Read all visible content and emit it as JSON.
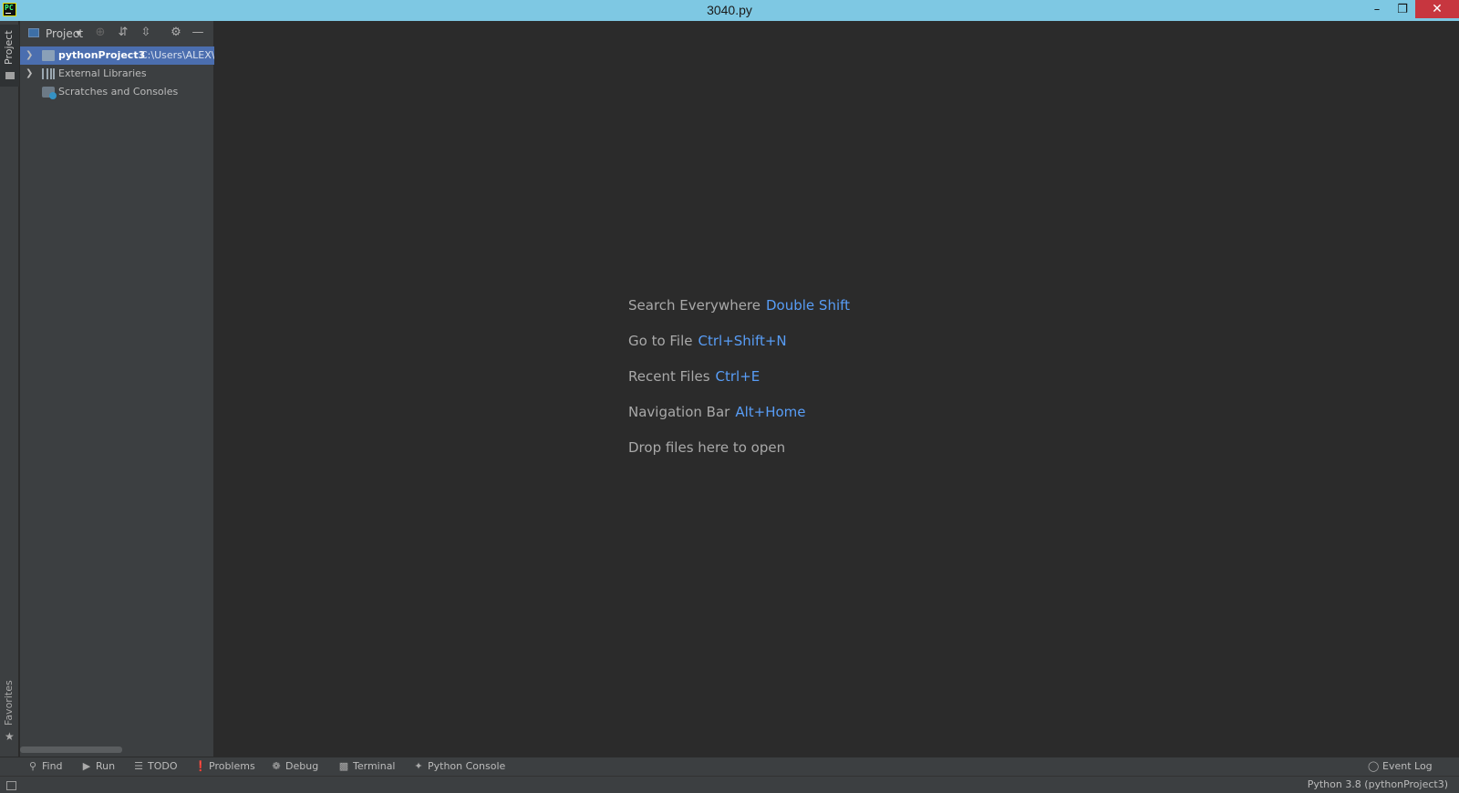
{
  "window": {
    "title": "3040.py",
    "icon_label": "PC",
    "minimize": "–",
    "restore": "❐",
    "close": "✕"
  },
  "left_strip": {
    "project_tab": "Project",
    "favorites_tab": "Favorites",
    "favorites_icon": "★"
  },
  "project_panel": {
    "title": "Project",
    "toolbar_icons": [
      "view-icon",
      "dropdown-icon",
      "locate-icon",
      "expand-all-icon",
      "collapse-all-icon",
      "settings-icon",
      "hide-icon"
    ],
    "tree": [
      {
        "label": "pythonProject3",
        "path": "C:\\Users\\ALEX\\",
        "expanded": false,
        "selected": true
      },
      {
        "label": "External Libraries",
        "expanded": false
      },
      {
        "label": "Scratches and Consoles"
      }
    ]
  },
  "editor": {
    "hints": [
      {
        "label": "Search Everywhere",
        "key": "Double Shift"
      },
      {
        "label": "Go to File",
        "key": "Ctrl+Shift+N"
      },
      {
        "label": "Recent Files",
        "key": "Ctrl+E"
      },
      {
        "label": "Navigation Bar",
        "key": "Alt+Home"
      }
    ],
    "drop_text": "Drop files here to open"
  },
  "bottom_bar": {
    "find": "Find",
    "run": "Run",
    "todo": "TODO",
    "problems": "Problems",
    "debug": "Debug",
    "terminal": "Terminal",
    "python_console": "Python Console",
    "event_log": "Event Log"
  },
  "status_bar": {
    "interpreter": "Python 3.8 (pythonProject3)"
  },
  "colors": {
    "titlebar": "#7ec8e3",
    "close": "#c7363f",
    "panel": "#3c3f41",
    "editor": "#2b2b2b",
    "selection": "#4b6eaf",
    "shortcut": "#589df6"
  }
}
